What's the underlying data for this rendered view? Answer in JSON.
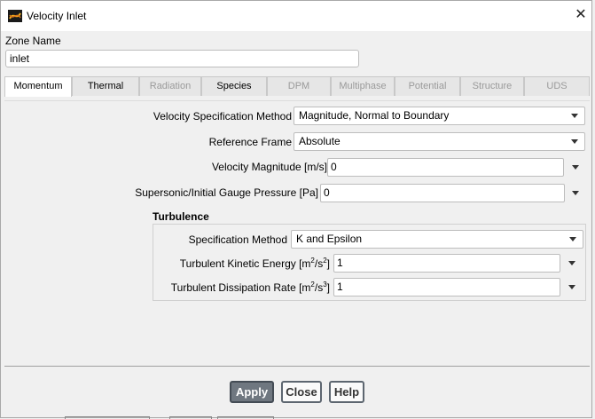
{
  "window": {
    "title": "Velocity Inlet"
  },
  "zone": {
    "label": "Zone Name",
    "value": "inlet"
  },
  "tabs": [
    {
      "label": "Momentum"
    },
    {
      "label": "Thermal"
    },
    {
      "label": "Radiation"
    },
    {
      "label": "Species"
    },
    {
      "label": "DPM"
    },
    {
      "label": "Multiphase"
    },
    {
      "label": "Potential"
    },
    {
      "label": "Structure"
    },
    {
      "label": "UDS"
    }
  ],
  "momentum": {
    "velocity_spec_label": "Velocity Specification Method",
    "velocity_spec_value": "Magnitude, Normal to Boundary",
    "ref_frame_label": "Reference Frame",
    "ref_frame_value": "Absolute",
    "vel_mag_label": "Velocity Magnitude [m/s]",
    "vel_mag_value": "0",
    "pressure_label": "Supersonic/Initial Gauge Pressure [Pa]",
    "pressure_value": "0"
  },
  "turbulence": {
    "title": "Turbulence",
    "spec_label": "Specification Method",
    "spec_value": "K and Epsilon",
    "tke_label": "Turbulent Kinetic Energy [m",
    "tke_unit_exp1": "2",
    "tke_unit_mid": "/s",
    "tke_unit_exp2": "2",
    "tke_unit_end": "]",
    "tke_value": "1",
    "tdr_label": "Turbulent Dissipation Rate [m",
    "tdr_unit_exp1": "2",
    "tdr_unit_mid": "/s",
    "tdr_unit_exp2": "3",
    "tdr_unit_end": "]",
    "tdr_value": "1"
  },
  "buttons": {
    "apply": "Apply",
    "close": "Close",
    "help": "Help"
  },
  "icons": {
    "close": "close-icon",
    "app": "fluent-app-icon",
    "dropdown": "chevron-down-icon"
  },
  "colors": {
    "primary_button": "#6f7780",
    "window_bg": "#f0f0f0"
  }
}
